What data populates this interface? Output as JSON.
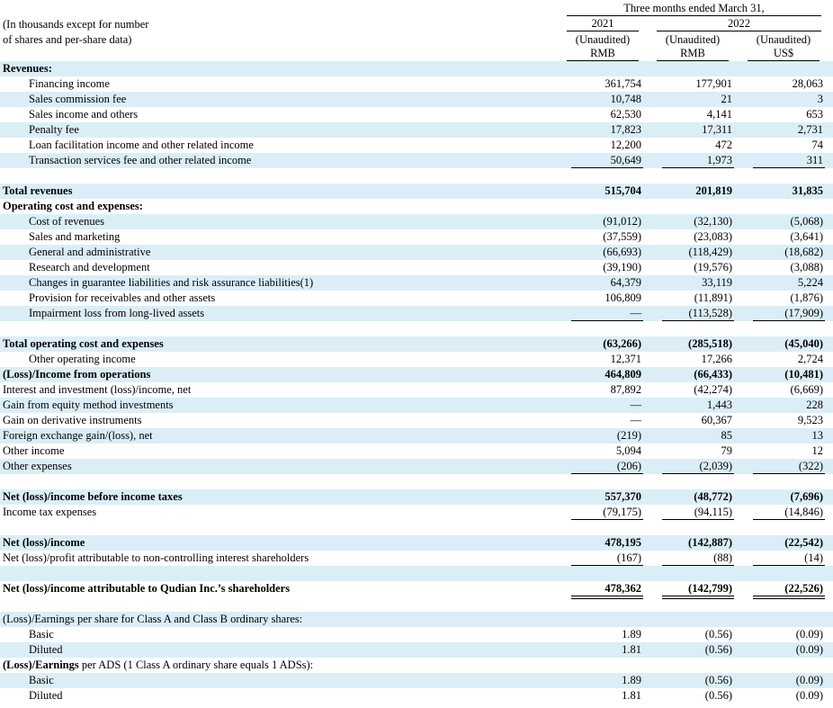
{
  "header": {
    "units_note_line1": "(In thousands except for number",
    "units_note_line2": "of shares and per-share data)",
    "period": "Three months ended March 31,",
    "year_a": "2021",
    "year_b": "2022",
    "col1_status": "(Unaudited)",
    "col1_currency": "RMB",
    "col2_status": "(Unaudited)",
    "col2_currency": "RMB",
    "col3_status": "(Unaudited)",
    "col3_currency": "US$"
  },
  "rows": [
    {
      "label": "Revenues:",
      "bold": true,
      "shade": true
    },
    {
      "label": "Financing income",
      "indent": true,
      "v": [
        "361,754",
        "177,901",
        "28,063"
      ]
    },
    {
      "label": "Sales commission fee",
      "indent": true,
      "shade": true,
      "v": [
        "10,748",
        "21",
        "3"
      ]
    },
    {
      "label": "Sales income and others",
      "indent": true,
      "v": [
        "62,530",
        "4,141",
        "653"
      ]
    },
    {
      "label": "Penalty fee",
      "indent": true,
      "shade": true,
      "v": [
        "17,823",
        "17,311",
        "2,731"
      ]
    },
    {
      "label": "Loan facilitation income and other related income",
      "indent": true,
      "v": [
        "12,200",
        "472",
        "74"
      ]
    },
    {
      "label": "Transaction services fee and other related income",
      "indent": true,
      "shade": true,
      "v": [
        "50,649",
        "1,973",
        "311"
      ],
      "underline": true
    },
    {
      "label": "",
      "spacer": true
    },
    {
      "label": "Total revenues",
      "bold": true,
      "shade": true,
      "v": [
        "515,704",
        "201,819",
        "31,835"
      ]
    },
    {
      "label": "Operating cost and expenses:",
      "bold": true
    },
    {
      "label": "Cost of revenues",
      "indent": true,
      "shade": true,
      "v": [
        "(91,012)",
        "(32,130)",
        "(5,068)"
      ]
    },
    {
      "label": "Sales and marketing",
      "indent": true,
      "v": [
        "(37,559)",
        "(23,083)",
        "(3,641)"
      ]
    },
    {
      "label": "General and administrative",
      "indent": true,
      "shade": true,
      "v": [
        "(66,693)",
        "(118,429)",
        "(18,682)"
      ]
    },
    {
      "label": "Research and development",
      "indent": true,
      "v": [
        "(39,190)",
        "(19,576)",
        "(3,088)"
      ]
    },
    {
      "label": "Changes in guarantee liabilities and risk assurance liabilities(1)",
      "indent": true,
      "shade": true,
      "v": [
        "64,379",
        "33,119",
        "5,224"
      ]
    },
    {
      "label": "Provision for receivables and other assets",
      "indent": true,
      "v": [
        "106,809",
        "(11,891)",
        "(1,876)"
      ]
    },
    {
      "label": "Impairment loss from long-lived assets",
      "indent": true,
      "shade": true,
      "v": [
        "—",
        "(113,528)",
        "(17,909)"
      ],
      "underline": true
    },
    {
      "label": "",
      "spacer": true
    },
    {
      "label": "Total operating cost and expenses",
      "bold": true,
      "shade": true,
      "v": [
        "(63,266)",
        "(285,518)",
        "(45,040)"
      ]
    },
    {
      "label": "Other operating income",
      "indent": true,
      "v": [
        "12,371",
        "17,266",
        "2,724"
      ]
    },
    {
      "label": "(Loss)/Income from operations",
      "bold": true,
      "shade": true,
      "v": [
        "464,809",
        "(66,433)",
        "(10,481)"
      ]
    },
    {
      "label": "Interest and investment (loss)/income, net",
      "v": [
        "87,892",
        "(42,274)",
        "(6,669)"
      ]
    },
    {
      "label": "Gain from equity method investments",
      "shade": true,
      "v": [
        "—",
        "1,443",
        "228"
      ]
    },
    {
      "label": "Gain on derivative instruments",
      "v": [
        "—",
        "60,367",
        "9,523"
      ]
    },
    {
      "label": "Foreign exchange gain/(loss), net",
      "shade": true,
      "v": [
        "(219)",
        "85",
        "13"
      ]
    },
    {
      "label": "Other income",
      "v": [
        "5,094",
        "79",
        "12"
      ]
    },
    {
      "label": "Other expenses",
      "shade": true,
      "v": [
        "(206)",
        "(2,039)",
        "(322)"
      ],
      "underline": true
    },
    {
      "label": "",
      "spacer": true
    },
    {
      "label": "Net (loss)/income before income taxes",
      "bold": true,
      "shade": true,
      "v": [
        "557,370",
        "(48,772)",
        "(7,696)"
      ]
    },
    {
      "label": "Income tax expenses",
      "v": [
        "(79,175)",
        "(94,115)",
        "(14,846)"
      ],
      "underline": true
    },
    {
      "label": "",
      "spacer": true
    },
    {
      "label": "Net (loss)/income",
      "bold": true,
      "shade": true,
      "v": [
        "478,195",
        "(142,887)",
        "(22,542)"
      ]
    },
    {
      "label": "Net (loss)/profit attributable to non-controlling interest shareholders",
      "v": [
        "(167)",
        "(88)",
        "(14)"
      ],
      "underline": true
    },
    {
      "label": "",
      "spacer": true,
      "shade": true
    },
    {
      "label": "Net (loss)/income attributable to Qudian Inc.’s shareholders",
      "bold": true,
      "v": [
        "478,362",
        "(142,799)",
        "(22,526)"
      ],
      "double": true
    },
    {
      "label": "",
      "spacer": true
    },
    {
      "label": "(Loss)/Earnings per share for Class A and Class B ordinary shares:",
      "shade": true
    },
    {
      "label": "Basic",
      "indent": true,
      "v": [
        "1.89",
        "(0.56)",
        "(0.09)"
      ]
    },
    {
      "label": "Diluted",
      "indent": true,
      "shade": true,
      "v": [
        "1.81",
        "(0.56)",
        "(0.09)"
      ]
    },
    {
      "label": "(Loss)/Earnings per ADS (1 Class A ordinary share equals 1 ADSs):",
      "boldprefix": "(Loss)/Earnings"
    },
    {
      "label": "Basic",
      "indent": true,
      "shade": true,
      "v": [
        "1.89",
        "(0.56)",
        "(0.09)"
      ]
    },
    {
      "label": "Diluted",
      "indent": true,
      "v": [
        "1.81",
        "(0.56)",
        "(0.09)"
      ]
    }
  ]
}
